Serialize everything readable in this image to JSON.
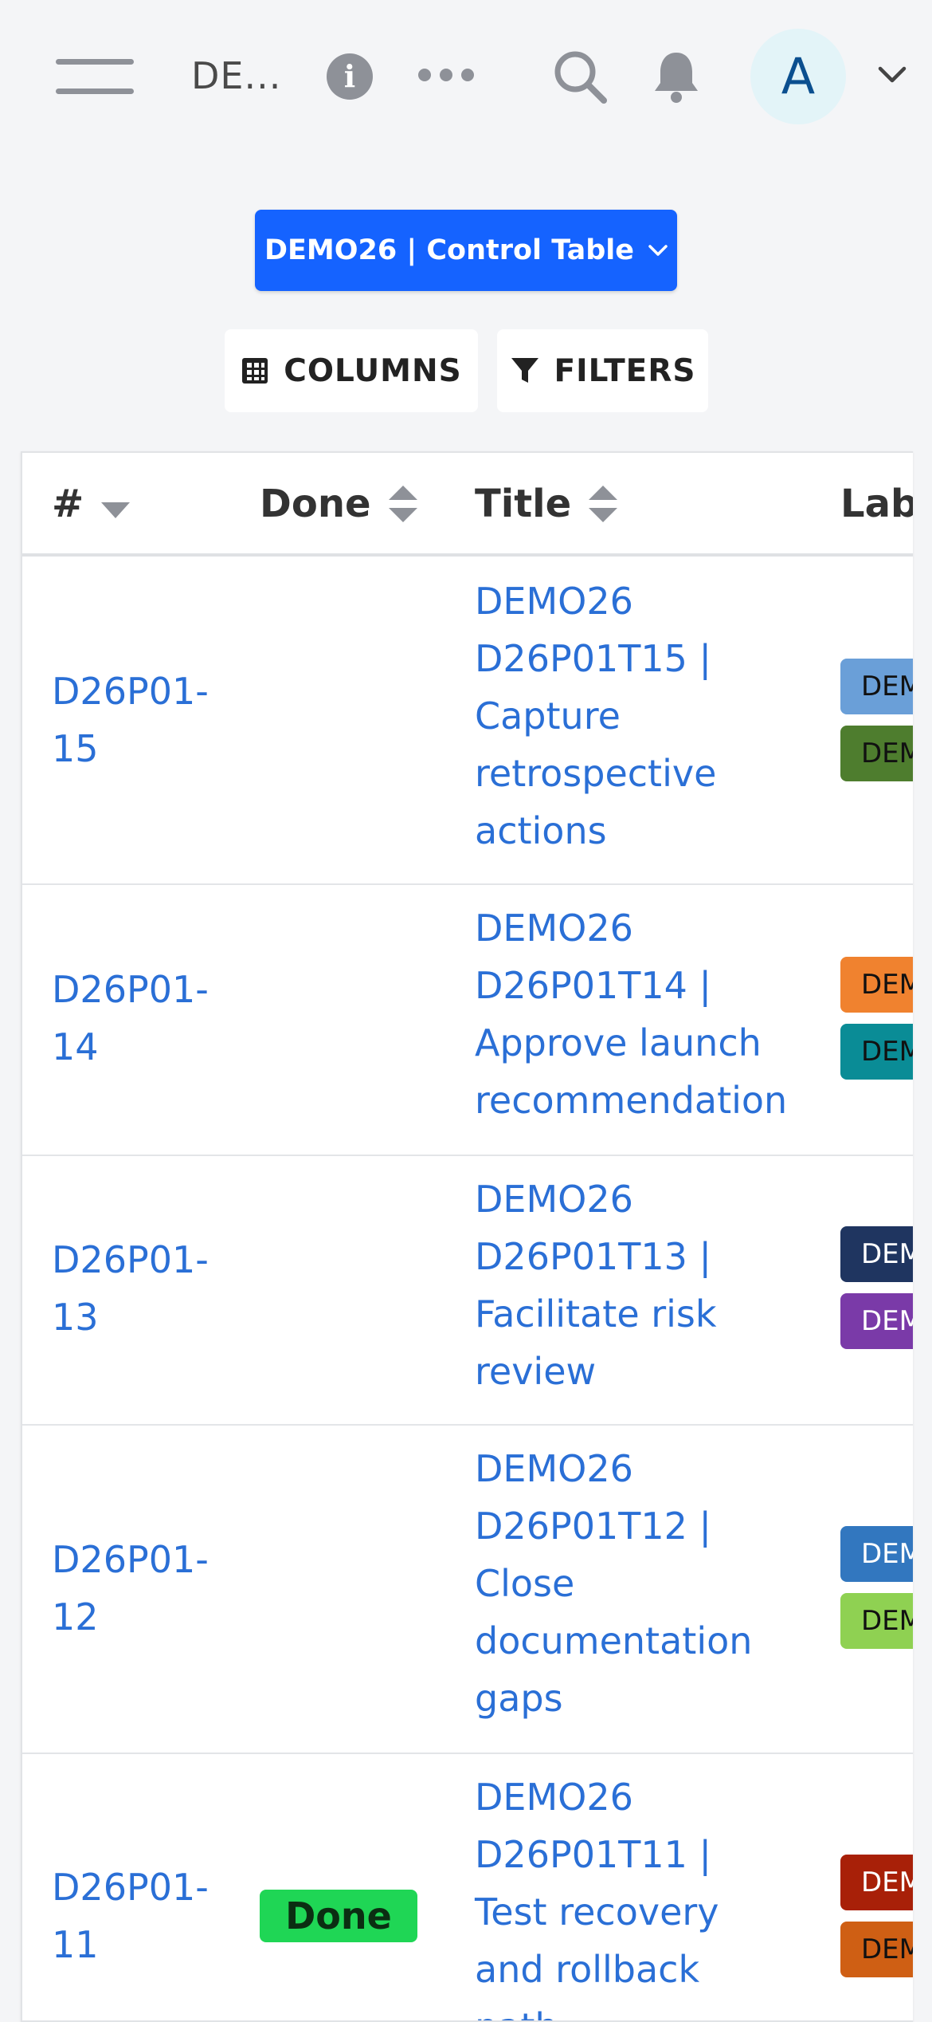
{
  "header": {
    "project_label": "DE...",
    "avatar_letter": "A"
  },
  "board_selector": {
    "label": "DEMO26 | Control Table"
  },
  "toolbar": {
    "columns_label": "COLUMNS",
    "filters_label": "FILTERS"
  },
  "table": {
    "columns": [
      "#",
      "Done",
      "Title",
      "Labe"
    ],
    "rows": [
      {
        "id": "D26P01-15",
        "id_lines": [
          "D26P01-",
          "15"
        ],
        "done": "",
        "title_lines": [
          "DEMO26",
          "D26P01T15 |",
          "Capture",
          "retrospective",
          "actions"
        ],
        "labels": [
          {
            "text": "DEM",
            "color": "#6a9fd8",
            "text_color": "#111"
          },
          {
            "text": "DEM",
            "color": "#4e7d2e",
            "text_color": "#111"
          }
        ]
      },
      {
        "id": "D26P01-14",
        "id_lines": [
          "D26P01-",
          "14"
        ],
        "done": "",
        "title_lines": [
          "DEMO26",
          "D26P01T14 |",
          "Approve launch",
          "recommendation"
        ],
        "labels": [
          {
            "text": "DEM",
            "color": "#f0822f",
            "text_color": "#111"
          },
          {
            "text": "DEM",
            "color": "#0a8c96",
            "text_color": "#111"
          }
        ]
      },
      {
        "id": "D26P01-13",
        "id_lines": [
          "D26P01-",
          "13"
        ],
        "done": "",
        "title_lines": [
          "DEMO26",
          "D26P01T13 |",
          "Facilitate risk",
          "review"
        ],
        "labels": [
          {
            "text": "DEM",
            "color": "#1f3560",
            "text_color": "#fff"
          },
          {
            "text": "DEM",
            "color": "#7a3aa8",
            "text_color": "#fff"
          }
        ]
      },
      {
        "id": "D26P01-12",
        "id_lines": [
          "D26P01-",
          "12"
        ],
        "done": "",
        "title_lines": [
          "DEMO26",
          "D26P01T12 |",
          "Close",
          "documentation",
          "gaps"
        ],
        "labels": [
          {
            "text": "DEM",
            "color": "#3277bf",
            "text_color": "#fff"
          },
          {
            "text": "DEM",
            "color": "#8fd152",
            "text_color": "#111"
          }
        ]
      },
      {
        "id": "D26P01-11",
        "id_lines": [
          "D26P01-",
          "11"
        ],
        "done": "Done",
        "title_lines": [
          "DEMO26",
          "D26P01T11 |",
          "Test recovery",
          "and rollback",
          "path"
        ],
        "labels": [
          {
            "text": "DEM",
            "color": "#a82008",
            "text_color": "#fff"
          },
          {
            "text": "DEM",
            "color": "#cf5f14",
            "text_color": "#111"
          }
        ]
      }
    ]
  }
}
